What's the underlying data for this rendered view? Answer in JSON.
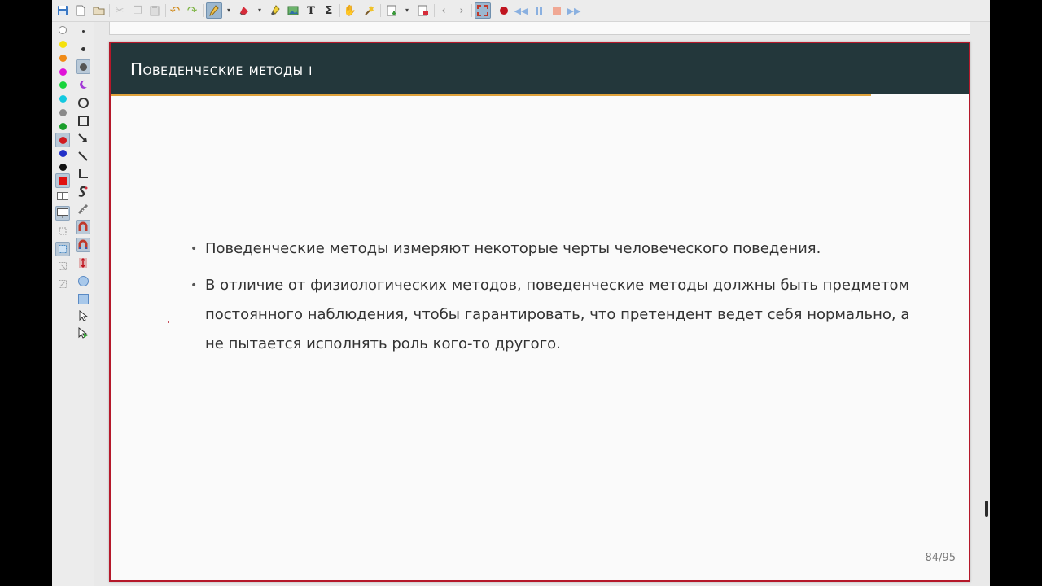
{
  "colors": {
    "slide_header": "#23373b",
    "slide_border": "#b5182a",
    "header_rule": "#e0a23b",
    "active_tool": "#9cb7cf"
  },
  "toolbar": {
    "icons": [
      "save-icon",
      "new-page-icon",
      "open-folder-icon",
      "cut-icon",
      "copy-icon",
      "paste-icon",
      "undo-icon",
      "redo-icon",
      "pen-tool-icon",
      "dropdown-arrow-icon",
      "eraser-icon",
      "dropdown-arrow-icon",
      "highlighter-icon",
      "image-icon",
      "text-icon",
      "latex-icon",
      "hand-icon",
      "select-tool-icon",
      "add-page-icon",
      "dropdown-arrow-icon",
      "delete-page-icon",
      "previous-page-icon",
      "next-page-icon",
      "fullscreen-icon",
      "record-icon",
      "rewind-icon",
      "pause-icon",
      "stop-icon",
      "fast-forward-icon"
    ]
  },
  "left_panel": {
    "colors": [
      "#ffffff",
      "#f5e10c",
      "#f08b17",
      "#e012d8",
      "#17d43b",
      "#13c9e0",
      "#8a8a8a",
      "#1a9e2b",
      "#d1191f",
      "#2230c8",
      "#111111"
    ],
    "selected_color": "#d1191f",
    "tools": [
      "small-dot-icon",
      "medium-dot-icon",
      "large-dot-icon",
      "crescent-icon",
      "circle-icon",
      "square-icon",
      "arrow-icon",
      "line-icon",
      "angle-icon",
      "spline-icon",
      "ruler-icon",
      "magnet-icon",
      "magnet-fill-icon",
      "vertical-space-icon",
      "ellipse-fill-icon",
      "rectangle-fill-icon",
      "cursor-icon",
      "play-cursor-icon"
    ]
  },
  "slide": {
    "title": "Поведенческие методы i",
    "bullets": [
      "Поведенческие методы измеряют некоторые черты человеческого поведения.",
      "В отличие от физиологических методов, поведенческие методы должны быть предметом постоянного наблюдения, чтобы гарантировать, что претендент ведет себя нормально, а не пытается исполнять роль кого-то другого."
    ],
    "page_number": "84/95",
    "bullet_mark": "•"
  }
}
